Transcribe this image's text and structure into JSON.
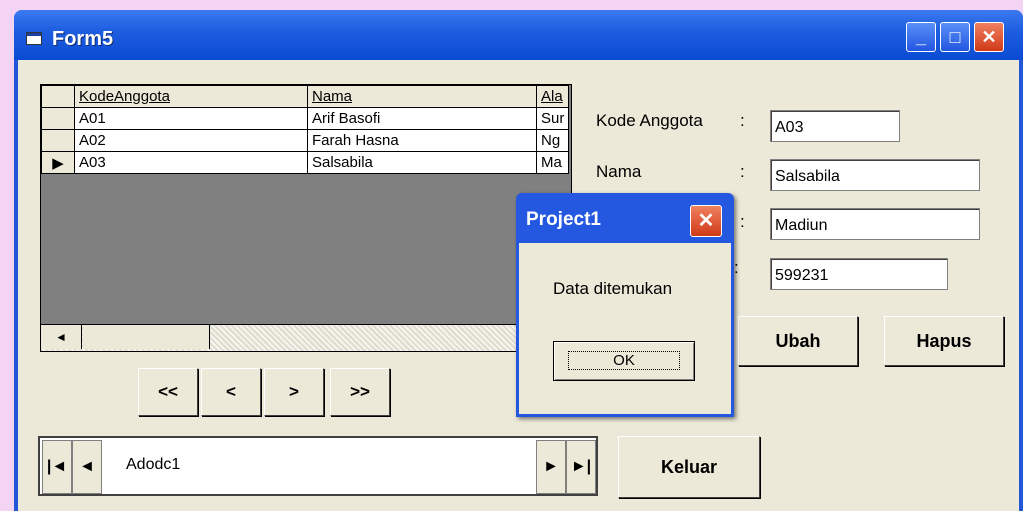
{
  "window": {
    "title": "Form5",
    "min": "_",
    "max": "□",
    "close": "✕"
  },
  "grid": {
    "columns": [
      "KodeAnggota",
      "Nama",
      "Ala"
    ],
    "rows": [
      {
        "indicator": "",
        "kode": "A01",
        "nama": "Arif Basofi",
        "alamat": "Sur"
      },
      {
        "indicator": "",
        "kode": "A02",
        "nama": "Farah Hasna",
        "alamat": "Ng"
      },
      {
        "indicator": "▶",
        "kode": "A03",
        "nama": "Salsabila",
        "alamat": "Ma"
      }
    ],
    "scroll_left": "◄"
  },
  "nav": {
    "first": "<<",
    "prev": "<",
    "next": ">",
    "last": ">>"
  },
  "adodc": {
    "caption": "Adodc1",
    "first": "|◄",
    "prev": "◄",
    "next": "►",
    "last": "►|"
  },
  "form": {
    "kode_label": "Kode Anggota",
    "kode_value": "A03",
    "nama_label": "Nama",
    "nama_value": "Salsabila",
    "alamat_value": "Madiun",
    "telp_value": "599231",
    "colon": ":"
  },
  "buttons": {
    "ubah": "Ubah",
    "hapus": "Hapus",
    "keluar": "Keluar"
  },
  "dialog": {
    "title": "Project1",
    "close": "✕",
    "message": "Data ditemukan",
    "ok": "OK"
  }
}
